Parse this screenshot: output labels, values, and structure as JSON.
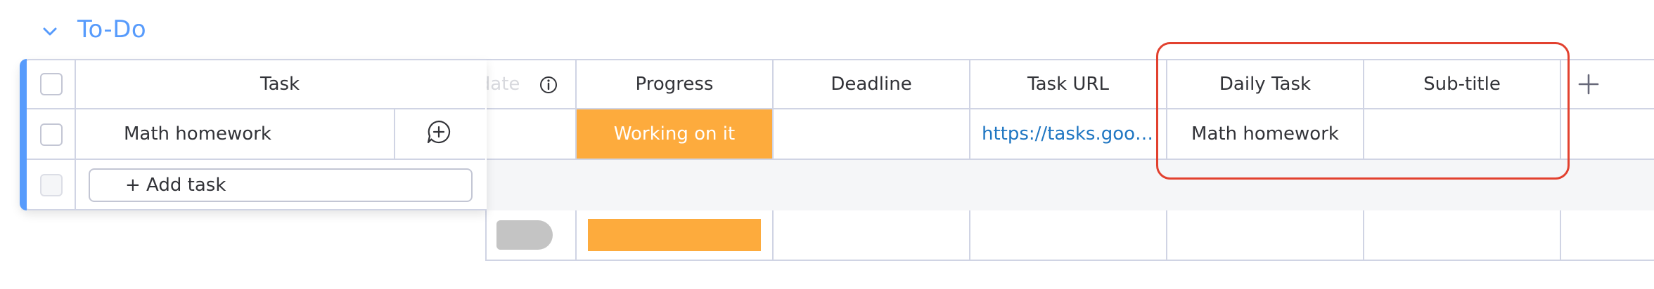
{
  "group": {
    "title": "To-Do",
    "color": "#579bfc",
    "collapse_icon": "chevron-down-icon"
  },
  "columns": {
    "task": "Task",
    "due_date": "Due date",
    "due_date_info_icon": "info-icon",
    "progress": "Progress",
    "deadline": "Deadline",
    "task_url": "Task URL",
    "daily_task": "Daily Task",
    "sub_title": "Sub-title",
    "add_column_icon": "plus-icon"
  },
  "rows": [
    {
      "task": "Math homework",
      "progress": "Working on it",
      "progress_color": "#fdab3d",
      "task_url": "https://tasks.goo…",
      "daily_task": "Math homework",
      "sub_title": "",
      "update_icon": "add-update-icon"
    }
  ],
  "add_task": {
    "label": "+ Add task"
  },
  "highlight_color": "#e2412f"
}
